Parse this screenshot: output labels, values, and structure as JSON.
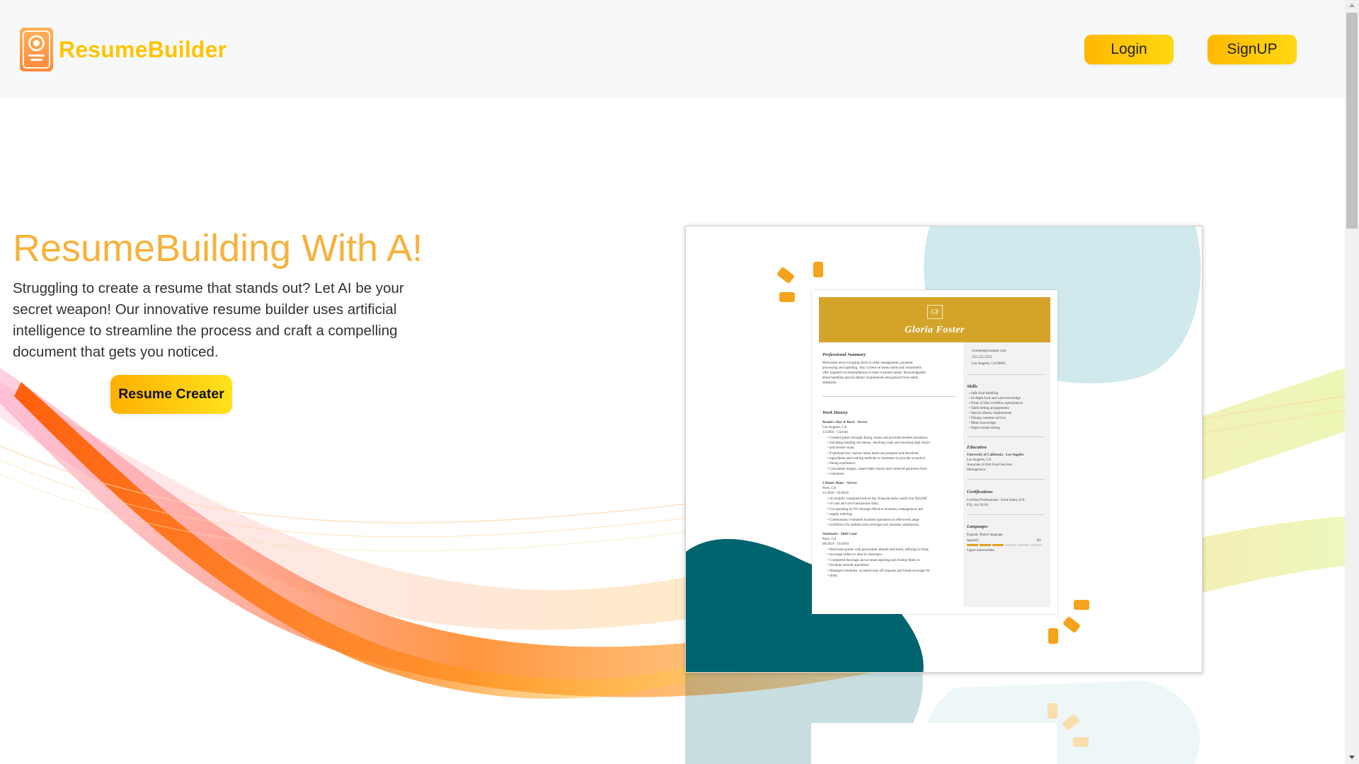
{
  "header": {
    "brand": "ResumeBuilder",
    "login_label": "Login",
    "signup_label": "SignUP"
  },
  "hero": {
    "title": "ResumeBuilding With A!",
    "description": "Struggling to create a resume that stands out? Let AI be your secret weapon! Our innovative resume builder uses artificial intelligence to streamline the process and craft a compelling document that gets you noticed.",
    "cta_label": "Resume Creater"
  },
  "preview": {
    "monogram": "GF",
    "name": "Gloria Foster",
    "summary_heading": "Professional Summary",
    "summary_text": [
      "Motivated server bringing skills in order management, payment",
      "processing and upselling. Stay current on menu items and consistently",
      "offer targeted recommendations to meet customer needs. Knowledgeable",
      "about handling special dietary requirements and general food safety",
      "standards."
    ],
    "work_heading": "Work History",
    "jobs": [
      {
        "title": "Brooks's Bar & Bowl - Server",
        "place": "Los Angeles, CA",
        "dates": "12/2016 - Current",
        "bullets": [
          "Greeted guests through dining rooms and provided needed assistance,",
          "including handing out menus, checking coats and returning high chairs",
          "and booster seats.",
          "Explained how various menu items are prepared and described",
          "ingredients and cooking methods to customers to provide a positive",
          "dining experience.",
          "Calculated charges, issued table checks and collected payments from",
          "customers."
        ]
      },
      {
        "title": "2 Dunes Diner - Server",
        "place": "Paris, CA",
        "dates": "11/2010 - 03/2016",
        "bullets": [
          "Accurately completed end-of-day financial tasks worth over $10,000",
          "of cash and card transactions daily.",
          "Cut spending by 8% through effective inventory management and",
          "supply ordering.",
          "Continuously evaluated business operations to effectively align",
          "workflows for optimal area coverage and customer satisfaction."
        ]
      },
      {
        "title": "Starbucks - Shift Lead",
        "place": "Paris, CA",
        "dates": "08/2010 - 10/2010",
        "bullets": [
          "Motivated guests with personable attitude and smile, offering to bring",
          "beverage orders to dine-in customers.",
          "Completed thorough and accurate opening and closing duties to",
          "facilitate smooth operations.",
          "Managed schedules, accepted time off requests and found coverage for",
          "shifts."
        ]
      }
    ],
    "contact": [
      "example@example.com",
      "555-555-5555",
      "Los Angeles, CA 90001"
    ],
    "skills_heading": "Skills",
    "skills": [
      "Safe food handling",
      "In-depth food and wine knowledge",
      "Point of Sale workflow optimization",
      "Table setting arrangements",
      "Special dietary requirements",
      "Dining customer service",
      "Menu knowledge",
      "High-volume dining"
    ],
    "education_heading": "Education",
    "education": [
      "University of California - Los Angeles",
      "Los Angeles, CA",
      "Associate of Arts Food Services",
      "Management"
    ],
    "cert_heading": "Certifications",
    "certs": [
      "Certified Professional - Food Safety (CP-",
      "FS), city 05/20"
    ],
    "lang_heading": "Languages",
    "lang_english": "English: Native language",
    "lang_spanish": "Spanish:",
    "lang_spanish_level_code": "B2",
    "lang_spanish_level": "Upper intermediate",
    "lang_spanish_bars_filled": 3
  },
  "colors": {
    "brand": "#ffc400",
    "title": "#f6b23b",
    "button": "#ffc400",
    "teal": "#00646f",
    "light_blue": "#cfe9ec",
    "resume_gold": "#d4a42a"
  }
}
